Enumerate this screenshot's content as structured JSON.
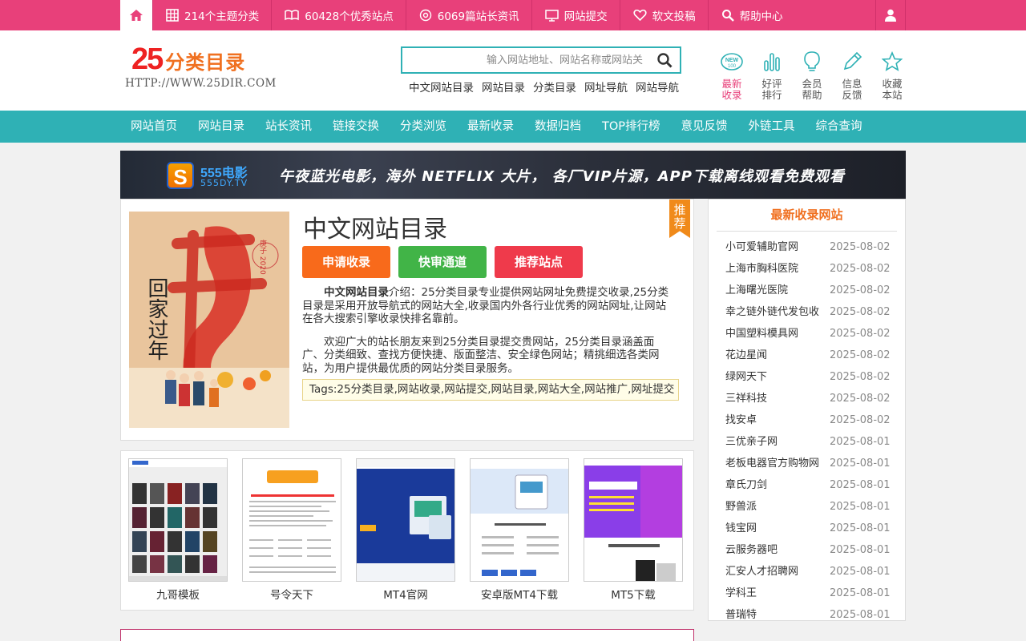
{
  "topbar": {
    "items": [
      {
        "label": "214个主题分类",
        "icon": "grid-icon"
      },
      {
        "label": "60428个优秀站点",
        "icon": "book-icon"
      },
      {
        "label": "6069篇站长资讯",
        "icon": "target-icon"
      },
      {
        "label": "网站提交",
        "icon": "monitor-icon"
      },
      {
        "label": "软文投稿",
        "icon": "heart-icon"
      },
      {
        "label": "帮助中心",
        "icon": "search-icon"
      }
    ]
  },
  "header": {
    "logo_number": "25",
    "logo_text": "分类目录",
    "logo_url": "HTTP://WWW.25DIR.COM",
    "search_placeholder": "输入网站地址、网站名称或网站关",
    "hot_links": [
      "中文网站目录",
      "网站目录",
      "分类目录",
      "网址导航",
      "网站导航"
    ],
    "quick": [
      {
        "line1": "最新",
        "line2": "收录",
        "icon": "new-badge-icon"
      },
      {
        "line1": "好评",
        "line2": "排行",
        "icon": "bar-chart-icon"
      },
      {
        "line1": "会员",
        "line2": "帮助",
        "icon": "lightbulb-icon"
      },
      {
        "line1": "信息",
        "line2": "反馈",
        "icon": "pencil-icon"
      },
      {
        "line1": "收藏",
        "line2": "本站",
        "icon": "star-icon"
      }
    ]
  },
  "nav": [
    "网站首页",
    "网站目录",
    "站长资讯",
    "链接交换",
    "分类浏览",
    "最新收录",
    "数据归档",
    "TOP排行榜",
    "意见反馈",
    "外链工具",
    "综合查询"
  ],
  "banner": {
    "brand_letter": "S",
    "brand_name": "555电影",
    "brand_url": "555DY.TV",
    "slogan": "午夜蓝光电影，海外 NETFLIX 大片，  各厂VIP片源，APP下载离线观看免费观看"
  },
  "site": {
    "ribbon": "推荐",
    "title": "中文网站目录",
    "buttons": [
      "申请收录",
      "快审通道",
      "推荐站点"
    ],
    "desc_name": "中文网站目录",
    "desc_1": "介绍：25分类目录专业提供网站网址免费提交收录,25分类目录是采用开放导航式的网站大全,收录国内外各行业优秀的网站网址,让网站在各大搜索引擎收录快排名靠前。",
    "desc_2": "欢迎广大的站长朋友来到25分类目录提交贵网站，25分类目录涵盖面广、分类细致、查找方便快捷、版面整洁、安全绿色网站；精挑细选各类网站，为用户提供最优质的网站分类目录服务。",
    "tags": "Tags:25分类目录,网站收录,网站提交,网站目录,网站大全,网站推广,网址提交",
    "poster_text": "回家过年",
    "poster_year": "庚子 2020"
  },
  "thumbs": [
    {
      "caption": "九哥模板"
    },
    {
      "caption": "号令天下"
    },
    {
      "caption": "MT4官网"
    },
    {
      "caption": "安卓版MT4下载"
    },
    {
      "caption": "MT5下载"
    }
  ],
  "sidebar": {
    "title": "最新收录网站",
    "items": [
      {
        "name": "小可爱辅助官网",
        "date": "2025-08-02"
      },
      {
        "name": "上海市胸科医院",
        "date": "2025-08-02"
      },
      {
        "name": "上海曙光医院",
        "date": "2025-08-02"
      },
      {
        "name": "幸之链外链代发包收",
        "date": "2025-08-02"
      },
      {
        "name": "中国塑料模具网",
        "date": "2025-08-02"
      },
      {
        "name": "花边星闻",
        "date": "2025-08-02"
      },
      {
        "name": "绿网天下",
        "date": "2025-08-02"
      },
      {
        "name": "三祥科技",
        "date": "2025-08-02"
      },
      {
        "name": "找安卓",
        "date": "2025-08-02"
      },
      {
        "name": "三优亲子网",
        "date": "2025-08-01"
      },
      {
        "name": "老板电器官方购物网",
        "date": "2025-08-01"
      },
      {
        "name": "章氏刀剑",
        "date": "2025-08-01"
      },
      {
        "name": "野兽派",
        "date": "2025-08-01"
      },
      {
        "name": "钱宝网",
        "date": "2025-08-01"
      },
      {
        "name": "云服务器吧",
        "date": "2025-08-01"
      },
      {
        "name": "汇安人才招聘网",
        "date": "2025-08-01"
      },
      {
        "name": "学科王",
        "date": "2025-08-01"
      },
      {
        "name": "普瑞特",
        "date": "2025-08-01"
      }
    ]
  }
}
